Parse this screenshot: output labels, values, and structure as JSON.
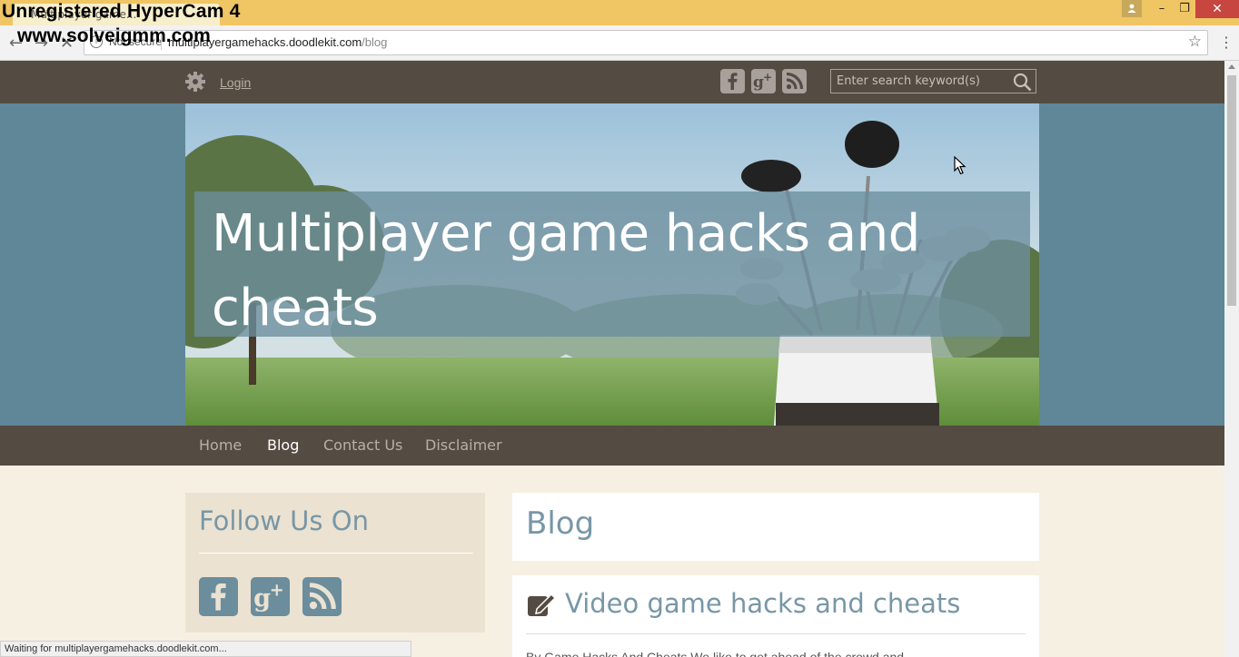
{
  "watermark": {
    "line1": "Unregistered HyperCam 4",
    "line2": "www.solveigmm.com"
  },
  "browser": {
    "tab_title": "Multiplayer game...",
    "security_label": "Not secure",
    "url_host": "multiplayergamehacks.doodlekit.com",
    "url_path": "/blog",
    "status_text": "Waiting for multiplayergamehacks.doodlekit.com...",
    "window_buttons": {
      "minimize": "–",
      "restore": "❐",
      "close": "✕"
    }
  },
  "header": {
    "login_label": "Login",
    "social": [
      {
        "name": "facebook",
        "glyph": "f"
      },
      {
        "name": "google-plus",
        "glyph": "g+"
      },
      {
        "name": "rss",
        "glyph": "rss"
      }
    ],
    "search_placeholder": "Enter search keyword(s)"
  },
  "hero": {
    "title": "Multiplayer game hacks and cheats"
  },
  "nav": {
    "items": [
      {
        "label": "Home",
        "active": false
      },
      {
        "label": "Blog",
        "active": true
      },
      {
        "label": "Contact Us",
        "active": false
      },
      {
        "label": "Disclaimer",
        "active": false
      }
    ]
  },
  "sidebar": {
    "title": "Follow Us On",
    "social": [
      {
        "name": "facebook",
        "glyph": "f"
      },
      {
        "name": "google-plus",
        "glyph": "g+"
      },
      {
        "name": "rss",
        "glyph": "rss"
      }
    ]
  },
  "main": {
    "heading": "Blog",
    "post": {
      "title": "Video game hacks and cheats",
      "excerpt": "By Game Hacks And Cheats We like to get ahead of the crowd and"
    }
  },
  "colors": {
    "accent": "#7897a6",
    "header_bg": "#544b43",
    "page_bg": "#f6f0e3",
    "hero_band": "#5f8797",
    "chrome_frame": "#f0c563"
  }
}
